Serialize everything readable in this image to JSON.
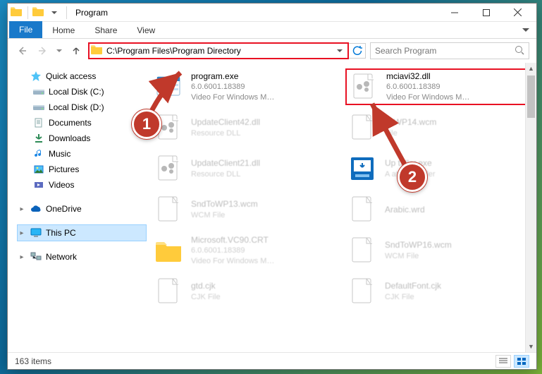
{
  "window": {
    "title": "Program"
  },
  "ribbon": {
    "tabs": [
      "File",
      "Home",
      "Share",
      "View"
    ]
  },
  "address": {
    "path": "C:\\Program Files\\Program Directory",
    "search_placeholder": "Search Program"
  },
  "sidebar": {
    "quick_access": {
      "label": "Quick access",
      "items": [
        {
          "label": "Local Disk (C:)",
          "icon": "drive-icon"
        },
        {
          "label": "Local Disk (D:)",
          "icon": "drive-icon"
        },
        {
          "label": "Documents",
          "icon": "documents-icon"
        },
        {
          "label": "Downloads",
          "icon": "downloads-icon"
        },
        {
          "label": "Music",
          "icon": "music-icon"
        },
        {
          "label": "Pictures",
          "icon": "pictures-icon"
        },
        {
          "label": "Videos",
          "icon": "videos-icon"
        }
      ]
    },
    "onedrive": {
      "label": "OneDrive"
    },
    "this_pc": {
      "label": "This PC"
    },
    "network": {
      "label": "Network"
    }
  },
  "files": [
    {
      "name": "program.exe",
      "line2": "6.0.6001.18389",
      "line3": "Video For Windows M…",
      "icon": "exe",
      "blur": false,
      "highlight": false
    },
    {
      "name": "mciavi32.dll",
      "line2": "6.0.6001.18389",
      "line3": "Video For Windows M…",
      "icon": "dll",
      "blur": false,
      "highlight": true
    },
    {
      "name": "UpdateClient42.dll",
      "line2": "Resource DLL",
      "line3": "",
      "icon": "dll",
      "blur": true,
      "highlight": false
    },
    {
      "name": "ToWP14.wcm",
      "line2": "File",
      "line3": "",
      "icon": "wcm",
      "blur": true,
      "highlight": false
    },
    {
      "name": "UpdateClient21.dll",
      "line2": "Resource DLL",
      "line3": "",
      "icon": "dll",
      "blur": true,
      "highlight": false
    },
    {
      "name": "Up       taller.exe",
      "line2": "A           ates installer",
      "line3": "",
      "icon": "installer",
      "blur": true,
      "highlight": false
    },
    {
      "name": "SndToWP13.wcm",
      "line2": "WCM File",
      "line3": "",
      "icon": "wcm",
      "blur": true,
      "highlight": false
    },
    {
      "name": "Arabic.wrd",
      "line2": "",
      "line3": "",
      "icon": "wrd",
      "blur": true,
      "highlight": false
    },
    {
      "name": "Microsoft.VC90.CRT",
      "line2": "6.0.6001.18389",
      "line3": "Video For Windows M…",
      "icon": "folder",
      "blur": true,
      "highlight": false
    },
    {
      "name": "SndToWP16.wcm",
      "line2": "WCM File",
      "line3": "",
      "icon": "wcm",
      "blur": true,
      "highlight": false
    },
    {
      "name": "gtd.cjk",
      "line2": "CJK File",
      "line3": "",
      "icon": "cjk",
      "blur": true,
      "highlight": false
    },
    {
      "name": "DefaultFont.cjk",
      "line2": "CJK File",
      "line3": "",
      "icon": "cjk",
      "blur": true,
      "highlight": false
    }
  ],
  "status": {
    "item_count": "163 items"
  },
  "callouts": {
    "c1": "1",
    "c2": "2"
  }
}
